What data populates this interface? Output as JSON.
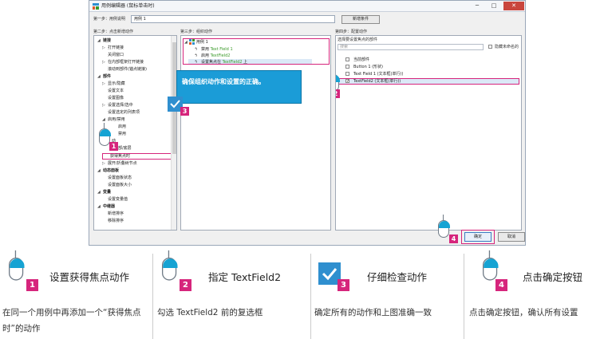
{
  "window": {
    "title": "用例编辑器 (鼠标单击时)",
    "controls": {
      "minimize": "─",
      "maximize": "□",
      "close": "✕"
    }
  },
  "step1": {
    "label": "第一步：用例说明",
    "case_name": "用例 1",
    "new_condition": "新增条件"
  },
  "step2": {
    "title": "第二步：点击新增动作",
    "tree": [
      {
        "label": "链接",
        "bold": true
      },
      {
        "label": "打开链接"
      },
      {
        "label": "关闭窗口"
      },
      {
        "label": "在内部框架打开链接"
      },
      {
        "label": "滚动到部件(锚点链接)"
      },
      {
        "label": "部件",
        "bold": true
      },
      {
        "label": "显示/隐藏"
      },
      {
        "label": "设置文本"
      },
      {
        "label": "设置图像"
      },
      {
        "label": "设置选择/选中"
      },
      {
        "label": "设置选定的列表项"
      },
      {
        "label": "启用/禁用"
      },
      {
        "label": "启用"
      },
      {
        "label": "禁用"
      },
      {
        "label": "动"
      },
      {
        "label": "于顶部/底层"
      },
      {
        "label": "获得焦点时"
      },
      {
        "label": "展开/折叠树节点"
      },
      {
        "label": "动态面板",
        "bold": true
      },
      {
        "label": "设置面板状态"
      },
      {
        "label": "设置面板大小"
      },
      {
        "label": "变量",
        "bold": true
      },
      {
        "label": "设置变量值"
      },
      {
        "label": "中继器",
        "bold": true
      },
      {
        "label": "新增排序"
      },
      {
        "label": "移除排序"
      }
    ]
  },
  "step3": {
    "title": "第三步：组织动作",
    "case_label": "用例 1",
    "actions": [
      {
        "prefix": "禁用",
        "target": "Text Field 1"
      },
      {
        "prefix": "启用",
        "target": "TextField2"
      },
      {
        "prefix": "设置焦点在",
        "target": "TextField2",
        "suffix": "上"
      }
    ]
  },
  "step4": {
    "title": "第四步：配置动作",
    "subtitle": "选择要设置焦点的部件",
    "filter_placeholder": "搜索",
    "hide_unnamed": "隐藏未命名的",
    "items": [
      {
        "label": "当前部件",
        "checked": false
      },
      {
        "label": "Button 1 (形状)",
        "checked": false
      },
      {
        "label": "Text Field 1 (文本框(单行))",
        "checked": false
      },
      {
        "label": "TextField2 (文本框(单行))",
        "checked": true
      }
    ]
  },
  "tooltip": "确保组织动作和设置的正确。",
  "buttons": {
    "ok": "确定",
    "cancel": "取消"
  },
  "markers": [
    "1",
    "2",
    "3",
    "4"
  ],
  "legend": [
    {
      "number": "1",
      "title": "设置获得焦点动作",
      "desc": "在同一个用例中再添加一个“获得焦点时”的动作"
    },
    {
      "number": "2",
      "title": "指定 TextField2",
      "desc": "勾选 TextField2 前的复选框"
    },
    {
      "number": "3",
      "title": "仔细检查动作",
      "desc": "确定所有的动作和上图准确一致"
    },
    {
      "number": "4",
      "title": "点击确定按钮",
      "desc": "点击确定按钮，确认所有设置"
    }
  ],
  "colors": {
    "accent": "#d6257c",
    "tooltip": "#1b9cd7",
    "icon_blue": "#2f8fcf"
  }
}
